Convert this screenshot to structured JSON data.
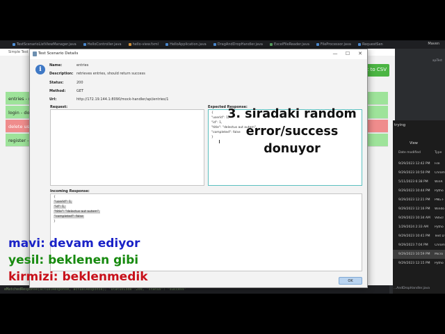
{
  "ide": {
    "tabs": [
      "TestScenarioListViewManager.java",
      "HelloController.java",
      "hello-view.fxml",
      "HelloApplication.java",
      "DragAndDropHandler.java",
      "ExcelFileReader.java",
      "FileProcessor.java",
      "RequestSen"
    ],
    "maven_label": "Maven",
    "aptest_label": "apiTest",
    "code_line": "eMatchedResponse(actualResponse, actualResponse);  \"statusCode\":200,  \"status\": \"success\"",
    "code_file": "...AndDropHandler.java"
  },
  "app": {
    "title": "Simple Test",
    "export_button": "t to CSV",
    "rows": [
      "entries - r",
      "login - do",
      "delete use",
      "register -"
    ]
  },
  "explorer": {
    "search_label": "trying",
    "view_label": "View",
    "col_date": "Date modified",
    "col_type": "Type",
    "rows": [
      {
        "date": "9/29/2023 12:42 PM",
        "type": "File"
      },
      {
        "date": "9/29/2023 10:50 PM",
        "type": "Chrom"
      },
      {
        "date": "5/11/2023 6:38 PM",
        "type": "WinR"
      },
      {
        "date": "9/29/2023 10:44 PM",
        "type": "Pytho"
      },
      {
        "date": "9/29/2023 12:21 PM",
        "type": "PNG F"
      },
      {
        "date": "9/29/2023 12:16 PM",
        "type": "Windo"
      },
      {
        "date": "9/29/2023 10:34 AM",
        "type": "VBScr"
      },
      {
        "date": "1/29/2024 2:33 AM",
        "type": "Pytho"
      },
      {
        "date": "9/29/2023 10:41 PM",
        "type": "Text D"
      },
      {
        "date": "9/29/2023 7:04 PM",
        "type": "Chrom"
      },
      {
        "date": "9/29/2023 10:59 PM",
        "type": "Micro"
      },
      {
        "date": "9/29/2023 12:15 PM",
        "type": "Pytho"
      }
    ]
  },
  "dialog": {
    "title": "Test Scenario Details",
    "name_label": "Name:",
    "name_value": "entries",
    "description_label": "Description:",
    "description_value": "retrieves entries, should return success",
    "status_label": "Status:",
    "status_value": "200",
    "method_label": "Method:",
    "method_value": "GET",
    "url_label": "Url:",
    "url_value": "http://172.19.144.1:8090/mock-handler/api/entries/1",
    "request_label": "Request:",
    "expected_label": "Expected Response:",
    "expected_lines": [
      "{",
      "  \"userId\": 1,",
      "  \"id\": 1,",
      "  \"title\": \"delectus aut autem\",",
      "  \"completed\": false",
      "}"
    ],
    "incoming_label": "Incoming Response:",
    "incoming_lines": [
      "{",
      "  \"userId\": 1,",
      "  \"id\": 1,",
      "  \"title\": \"delectus aut autem\",",
      "  \"completed\": false",
      "}"
    ],
    "ok_button": "OK",
    "minimize_glyph": "—",
    "maximize_glyph": "☐",
    "close_glyph": "✕"
  },
  "overlay": {
    "annotation_line1": "3. siradaki random",
    "annotation_line2": "error/success",
    "annotation_line3": "donuyor",
    "legend_blue": "mavi: devam ediyor",
    "legend_green": "yesil: beklenen gibi",
    "legend_red": "kirmizi: beklenmedik"
  }
}
